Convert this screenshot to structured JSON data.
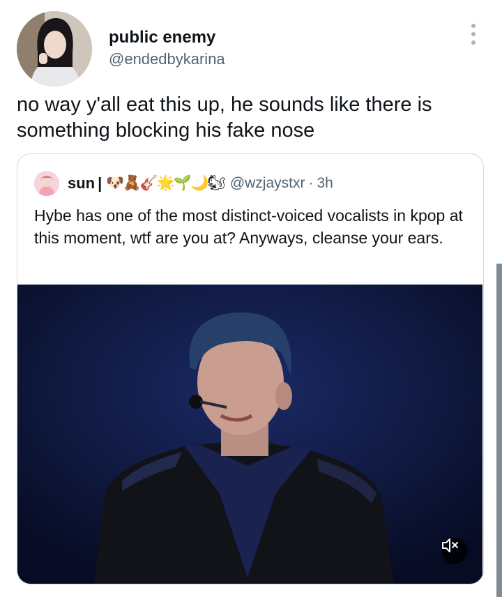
{
  "tweet": {
    "author": {
      "display_name": "public enemy",
      "handle": "@endedbykarina",
      "avatar_icon": "profile-photo"
    },
    "text": "no way y'all eat this up, he sounds like there is something blocking his fake nose",
    "more_icon": "more-vertical-icon"
  },
  "quoted_tweet": {
    "author": {
      "name": "sun",
      "separator": "|",
      "emojis": "🐶🧸🎸🌟🌱🌙🐿",
      "handle": "@wzjaystxr",
      "dot": "·",
      "time": "3h"
    },
    "text": "Hybe has one of the most distinct-voiced vocalists in kpop at this moment, wtf are you at? Anyways, cleanse your ears.",
    "media": {
      "type": "video",
      "mute_icon": "speaker-muted-icon"
    }
  },
  "colors": {
    "text_primary": "#0f1419",
    "text_secondary": "#536471",
    "border": "#cfd9de",
    "video_bg": "#0b1334"
  }
}
